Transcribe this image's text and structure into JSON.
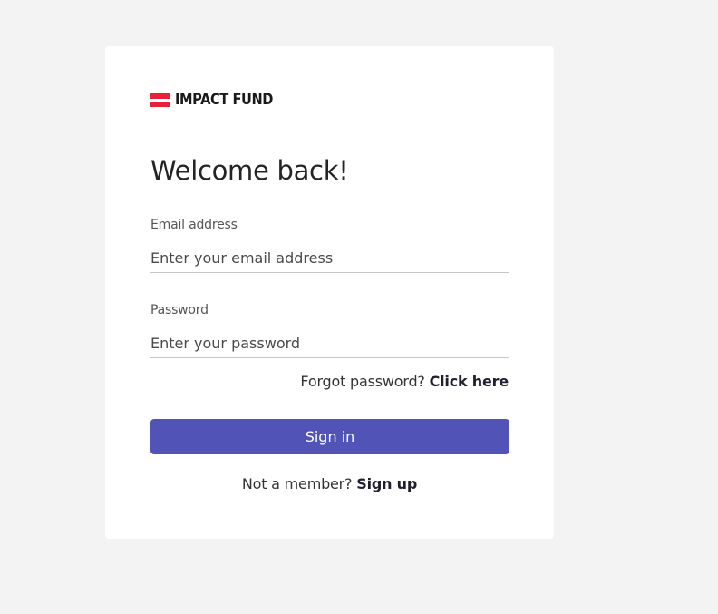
{
  "brand": {
    "name": "IMPACT FUND",
    "accent_color": "#e8213a",
    "icon": "flag-icon"
  },
  "login": {
    "title": "Welcome back!",
    "email": {
      "label": "Email address",
      "placeholder": "Enter your email address",
      "value": ""
    },
    "password": {
      "label": "Password",
      "placeholder": "Enter your password",
      "value": ""
    },
    "forgot": {
      "prompt": "Forgot password?",
      "link": "Click here"
    },
    "submit_label": "Sign in",
    "submit_color": "#5154b6",
    "signup": {
      "prompt": "Not a member?",
      "link": "Sign up"
    }
  }
}
